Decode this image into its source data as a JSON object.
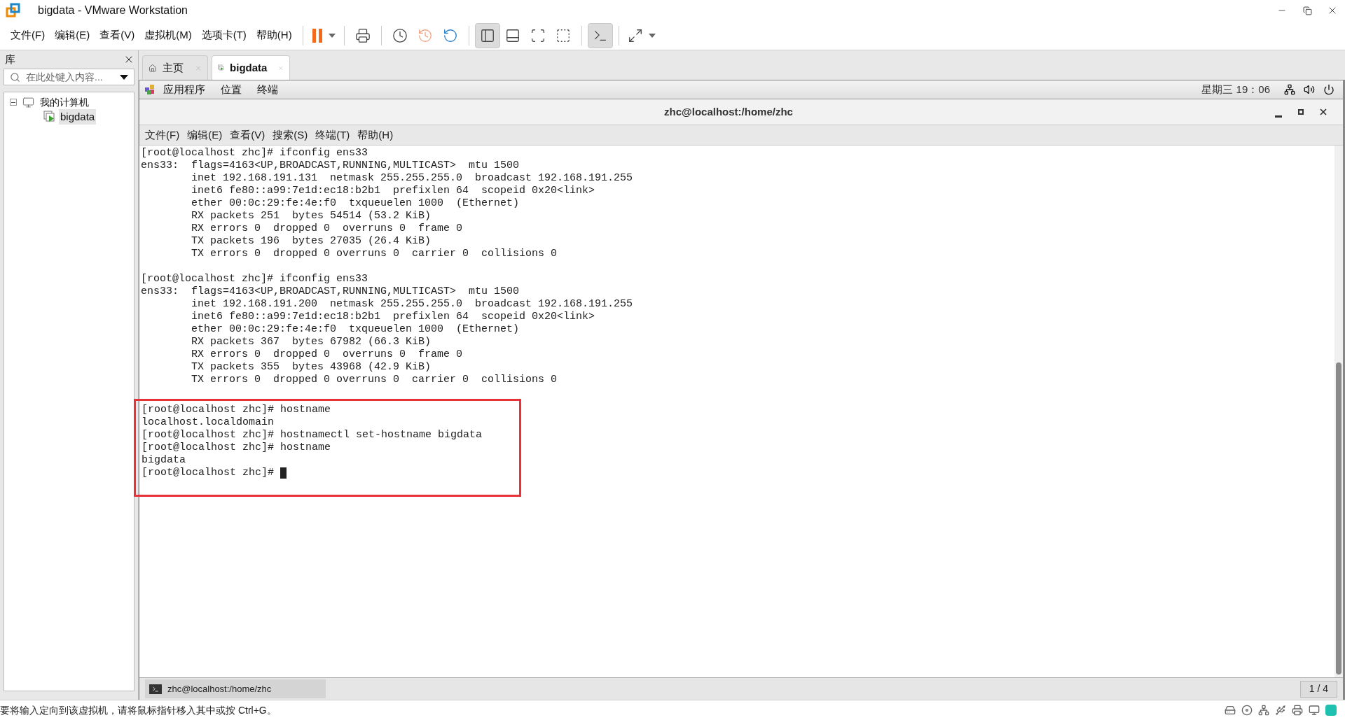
{
  "window": {
    "title": "bigdata - VMware Workstation"
  },
  "menu": [
    "文件(F)",
    "编辑(E)",
    "查看(V)",
    "虚拟机(M)",
    "选项卡(T)",
    "帮助(H)"
  ],
  "view_buttons": [
    {
      "selected": true
    },
    {
      "selected": false
    },
    {
      "selected": false
    },
    {
      "selected": false
    }
  ],
  "console_button": {
    "selected": true
  },
  "library": {
    "title": "库",
    "search": {
      "placeholder": "在此处键入内容..."
    },
    "tree": [
      {
        "label": "我的计算机",
        "expanded": true,
        "children": [
          {
            "label": "bigdata",
            "selected": true
          }
        ]
      }
    ]
  },
  "tabs": [
    {
      "kind": "home",
      "label": "主页",
      "selected": false
    },
    {
      "kind": "vm",
      "label": "bigdata",
      "selected": true
    }
  ],
  "guest_bar": {
    "menus": [
      "应用程序",
      "位置",
      "终端"
    ],
    "clock": "星期三 19：06"
  },
  "terminal": {
    "title": "zhc@localhost:/home/zhc",
    "menu": [
      "文件(F)",
      "编辑(E)",
      "查看(V)",
      "搜索(S)",
      "终端(T)",
      "帮助(H)"
    ],
    "cursor": true,
    "blocks": [
      {
        "highlighted": false,
        "lines": [
          "[root@localhost zhc]# ifconfig ens33",
          "ens33:  flags=4163<UP,BROADCAST,RUNNING,MULTICAST>  mtu 1500",
          "        inet 192.168.191.131  netmask 255.255.255.0  broadcast 192.168.191.255",
          "        inet6 fe80::a99:7e1d:ec18:b2b1  prefixlen 64  scopeid 0x20<link>",
          "        ether 00:0c:29:fe:4e:f0  txqueuelen 1000  (Ethernet)",
          "        RX packets 251  bytes 54514 (53.2 KiB)",
          "        RX errors 0  dropped 0  overruns 0  frame 0",
          "        TX packets 196  bytes 27035 (26.4 KiB)",
          "        TX errors 0  dropped 0 overruns 0  carrier 0  collisions 0"
        ]
      },
      {
        "highlighted": false,
        "lines": [
          "[root@localhost zhc]# ifconfig ens33",
          "ens33:  flags=4163<UP,BROADCAST,RUNNING,MULTICAST>  mtu 1500",
          "        inet 192.168.191.200  netmask 255.255.255.0  broadcast 192.168.191.255",
          "        inet6 fe80::a99:7e1d:ec18:b2b1  prefixlen 64  scopeid 0x20<link>",
          "        ether 00:0c:29:fe:4e:f0  txqueuelen 1000  (Ethernet)",
          "        RX packets 367  bytes 67982 (66.3 KiB)",
          "        RX errors 0  dropped 0  overruns 0  frame 0",
          "        TX packets 355  bytes 43968 (42.9 KiB)",
          "        TX errors 0  dropped 0 overruns 0  carrier 0  collisions 0"
        ]
      },
      {
        "highlighted": true,
        "lines": [
          "[root@localhost zhc]# hostname",
          "localhost.localdomain",
          "[root@localhost zhc]# hostnamectl set-hostname bigdata",
          "[root@localhost zhc]# hostname",
          "bigdata",
          "[root@localhost zhc]# "
        ]
      }
    ]
  },
  "taskbar": {
    "item": "zhc@localhost:/home/zhc",
    "pager": "1 / 4"
  },
  "status_bar": "要将输入定向到该虚拟机，请将鼠标指针移入其中或按 Ctrl+G。"
}
